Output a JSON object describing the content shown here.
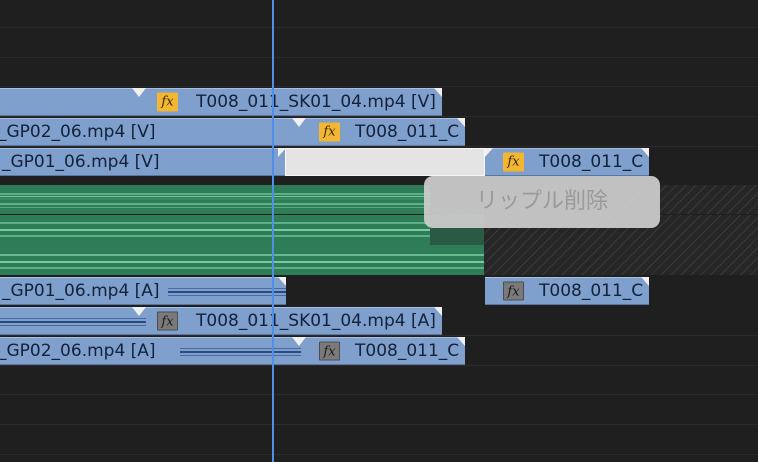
{
  "timeline": {
    "video_tracks": {
      "v3": [
        {
          "label": "T008_011_SK01_04.mp4 [V]",
          "fx": "fx"
        }
      ],
      "v2": [
        {
          "label": "_GP02_06.mp4 [V]"
        },
        {
          "label": "T008_011_C",
          "fx": "fx"
        }
      ],
      "v1": [
        {
          "label": "_GP01_06.mp4 [V]"
        },
        {
          "label": "T008_011_C",
          "fx": "fx"
        }
      ]
    },
    "audio_tracks": {
      "a4": [
        {
          "label": "_GP01_06.mp4 [A]"
        },
        {
          "label": "T008_011_C",
          "fx": "fx"
        }
      ],
      "a5": [
        {
          "label": "T008_011_SK01_04.mp4 [A]",
          "fx": "fx"
        }
      ],
      "a6": [
        {
          "label": "_GP02_06.mp4 [A]"
        },
        {
          "label": "T008_011_C",
          "fx": "fx"
        }
      ]
    },
    "tooltip": "リップル削除",
    "colors": {
      "clip": "#7f9fcc",
      "audio_wave_green": "#2f7d58",
      "fx_gold": "#f2b632",
      "fx_gray": "#7a7a7a",
      "playhead": "#4f8fe6",
      "background": "#1f1f1f"
    }
  }
}
